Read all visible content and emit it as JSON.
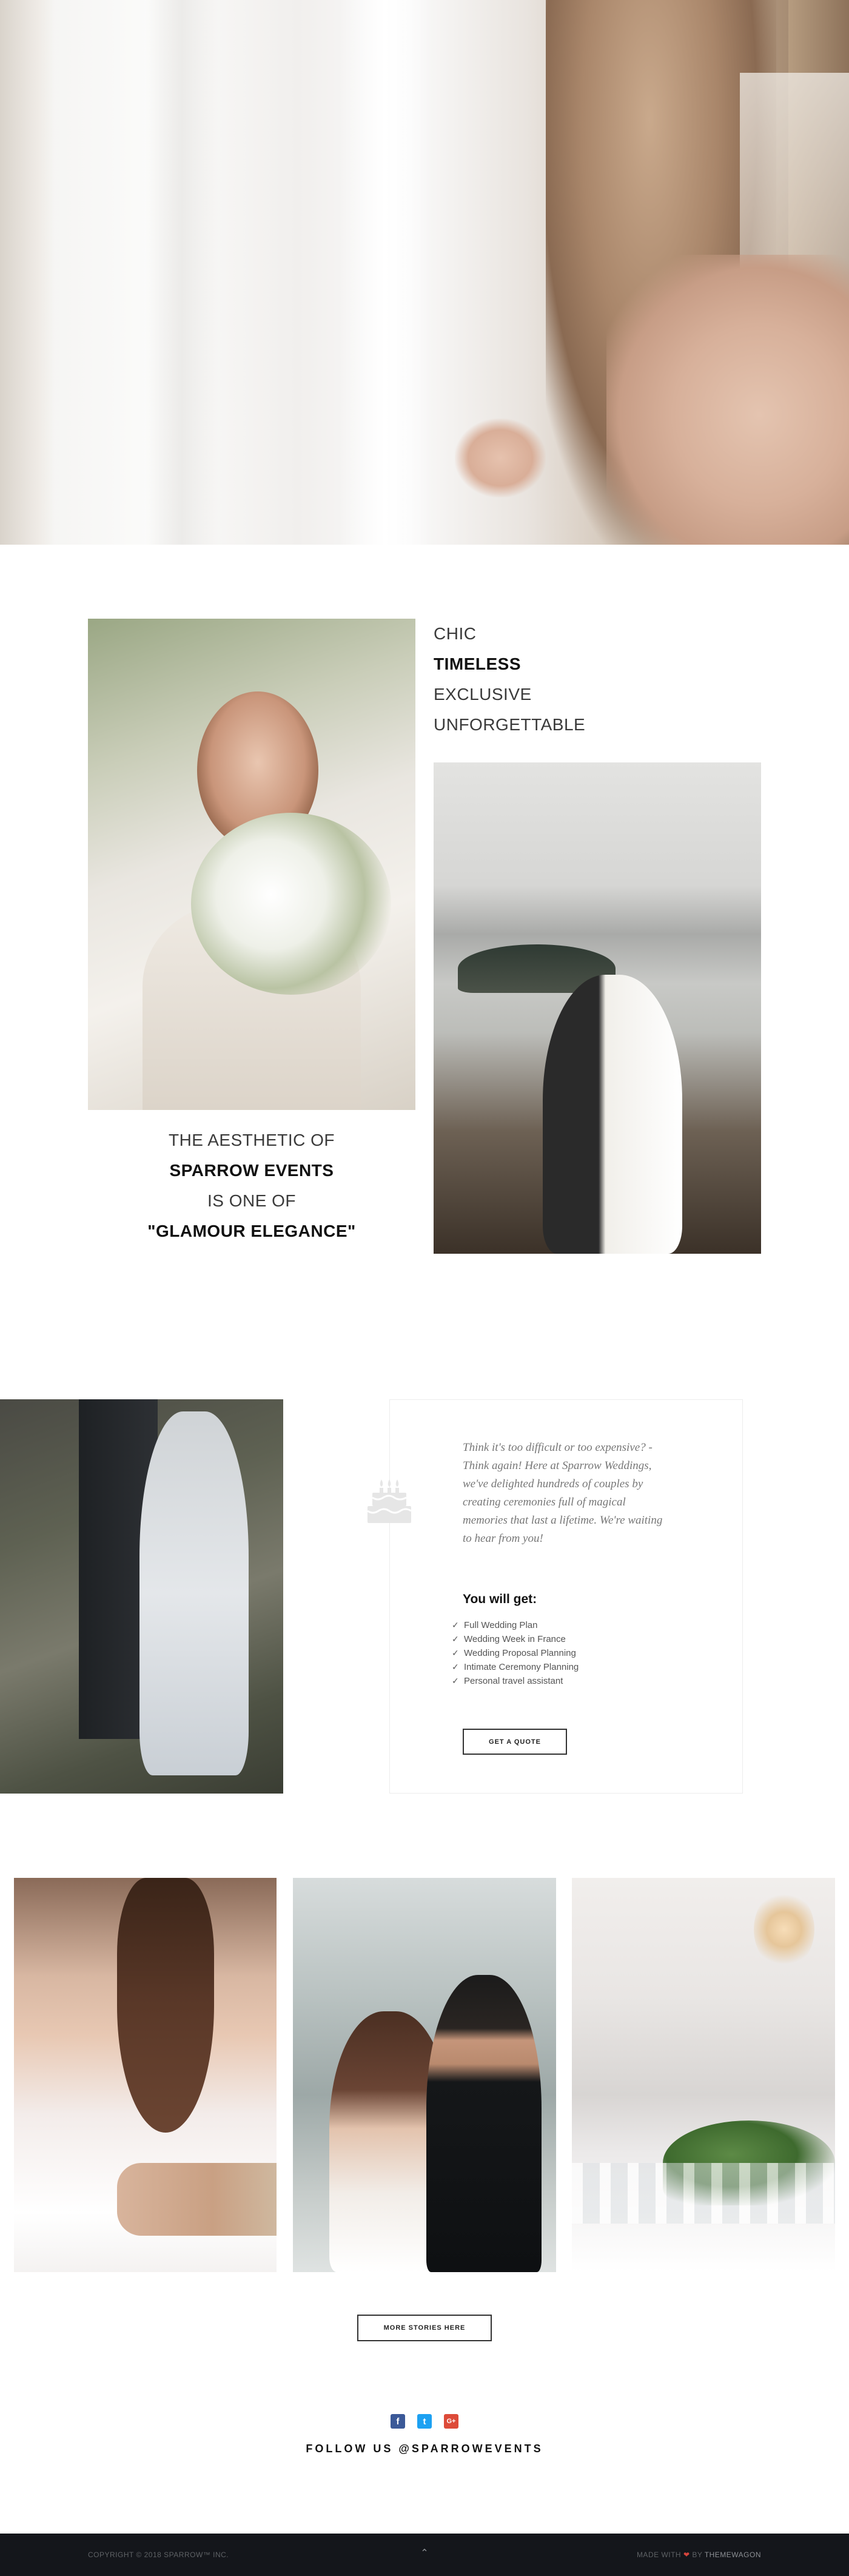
{
  "hero": {
    "image": "bride-by-window"
  },
  "intro": {
    "words": [
      "CHIC",
      "TIMELESS",
      "EXCLUSIVE",
      "UNFORGETTABLE"
    ],
    "aesthetic": {
      "line1": "THE AESTHETIC OF",
      "line2": "SPARROW EVENTS",
      "line3": "IS ONE OF",
      "line4": "\"GLAMOUR ELEGANCE\""
    }
  },
  "offer": {
    "icon": "wedding-cake-icon",
    "quote": "Think it's too difficult or too expensive? - Think again! Here at Sparrow Weddings, we've delighted hundreds of couples by creating ceremonies full of magical memories that last a lifetime. We're waiting to hear from you!",
    "heading": "You will get:",
    "items": [
      "Full Wedding Plan",
      "Wedding Week in France",
      "Wedding Proposal Planning",
      "Intimate Ceremony Planning",
      "Personal travel assistant"
    ],
    "cta": "GET A QUOTE"
  },
  "gallery": {
    "more_button": "MORE STORIES HERE"
  },
  "social": {
    "facebook": "f",
    "twitter": "t",
    "google": "G+",
    "follow_text": "FOLLOW US @SPARROWEVENTS"
  },
  "footer": {
    "copyright": "COPYRIGHT © 2018 SPARROW™ INC.",
    "made_with": "MADE WITH",
    "heart": "❤",
    "by": "BY",
    "author": "THEMEWAGON",
    "back_to_top": "⌃"
  },
  "colors": {
    "footer_bg": "#14161b",
    "facebook": "#3b5998",
    "twitter": "#1da1f2",
    "google": "#dd4b39",
    "heart": "#d6453d"
  }
}
